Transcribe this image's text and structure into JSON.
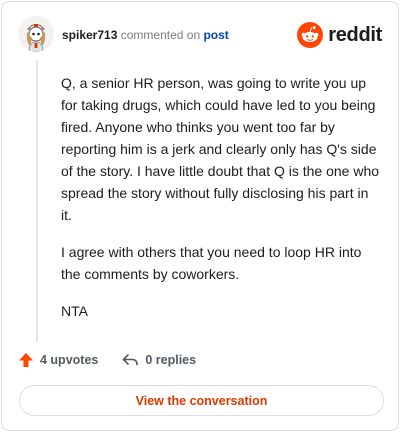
{
  "header": {
    "username": "spiker713",
    "action_text": "commented on",
    "target_link": "post",
    "brand": "reddit"
  },
  "comment": {
    "paragraphs": [
      "Q, a senior HR person, was going to write you up for taking drugs, which could have led to you being fired. Anyone who thinks you went too far by reporting him is a jerk and clearly only has Q's side of the story. I have little doubt that Q is the one who spread the story without fully disclosing his part in it.",
      "I agree with others that you need to loop HR into the comments by coworkers.",
      "NTA"
    ]
  },
  "actions": {
    "upvotes": "4 upvotes",
    "replies": "0 replies"
  },
  "cta": {
    "label": "View the conversation"
  },
  "colors": {
    "brand_orange": "#ff4500",
    "link_blue": "#0045ac",
    "cta_text": "#d93a00"
  }
}
